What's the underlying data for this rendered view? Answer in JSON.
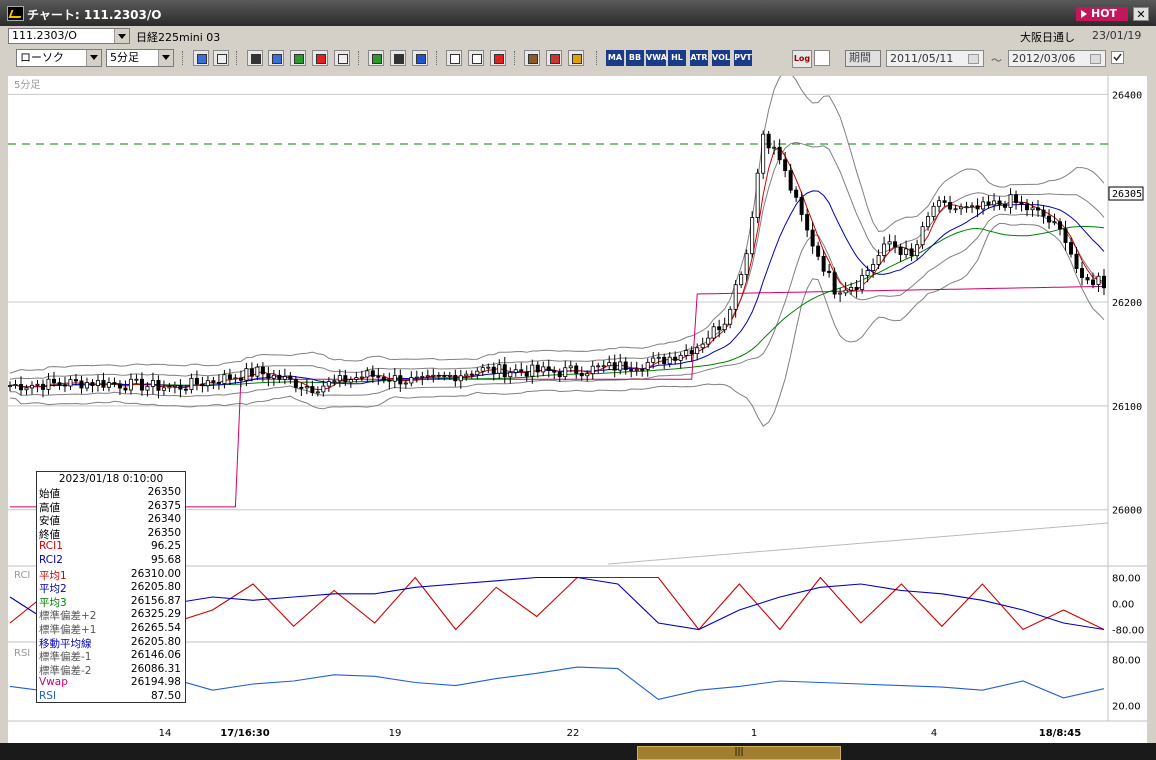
{
  "window": {
    "title": "チャート: 111.2303/O",
    "hot_label": "HOT",
    "close_label": "✕"
  },
  "header": {
    "symbol_code": "111.2303/O",
    "instrument_name": "日経225mini 03",
    "session": "大阪日通し",
    "date": "23/01/19"
  },
  "toolbar": {
    "chart_type": "ローソク",
    "interval": "5分足",
    "range_mode": "期間",
    "date_from": "2011/05/11",
    "date_to": "2012/03/06",
    "tilde": "〜",
    "icons": [
      "zoom-icon",
      "crosshair-icon",
      "grab-icon",
      "search-chart-icon",
      "bar-chart-icon",
      "candle-icon",
      "warning-icon",
      "pen-icon",
      "cursor-icon",
      "undo-icon",
      "candle-left-icon",
      "candle-right-icon",
      "all-icon",
      "gear-icon",
      "wrench-icon",
      "palette-icon"
    ],
    "indicator_buttons": [
      "MA",
      "BB",
      "VWAP",
      "HL",
      "ATR",
      "VOL",
      "PVT",
      "Log"
    ]
  },
  "chart": {
    "interval_label": "5分足",
    "price_labels": [
      "26400",
      "26305",
      "26200",
      "26100",
      "26000"
    ],
    "rci_label": "RCI",
    "rsi_label": "RSI",
    "rci_ticks": [
      "80.00",
      "0.00",
      "-80.00"
    ],
    "rsi_ticks": [
      "80.00",
      "20.00"
    ],
    "x_labels": [
      "14",
      "17/16:30",
      "19",
      "22",
      "1",
      "4",
      "18/8:45"
    ],
    "colors": {
      "up": "#ffffff",
      "down": "#000000",
      "ma1": "#d00000",
      "ma2": "#0000c0",
      "ma3": "#008000",
      "vwap": "#d0006a",
      "band": "#808080",
      "rsi": "#1e5fd6",
      "dashed": "#008000"
    }
  },
  "chart_data": {
    "type": "line",
    "title": "",
    "series": [
      {
        "name": "RCI1",
        "values": [
          -60,
          40,
          -70,
          50,
          -60,
          -20,
          60,
          -70,
          40,
          -60,
          80,
          -80,
          50,
          -40,
          80,
          80,
          80,
          -80,
          60,
          -80,
          80,
          -60,
          60,
          -70,
          60,
          -80,
          -20,
          -80
        ]
      },
      {
        "name": "RCI2",
        "values": [
          20,
          -60,
          -40,
          -30,
          0,
          20,
          10,
          20,
          30,
          30,
          50,
          60,
          70,
          80,
          80,
          60,
          -60,
          -80,
          -20,
          20,
          50,
          60,
          40,
          30,
          10,
          -20,
          -60,
          -80
        ]
      },
      {
        "name": "RSI",
        "values": [
          45,
          38,
          50,
          42,
          55,
          40,
          48,
          52,
          60,
          58,
          50,
          46,
          55,
          62,
          70,
          68,
          28,
          40,
          45,
          52,
          50,
          48,
          46,
          44,
          40,
          52,
          30,
          42
        ]
      }
    ],
    "ylim_price": [
      25940,
      26410
    ],
    "rci_ylim": [
      -100,
      100
    ],
    "rsi_ylim": [
      0,
      100
    ]
  },
  "infobox": {
    "datetime": "2023/01/18 0:10:00",
    "rows": [
      {
        "k": "始値",
        "v": "26350",
        "c": "#000000"
      },
      {
        "k": "高値",
        "v": "26375",
        "c": "#000000"
      },
      {
        "k": "安値",
        "v": "26340",
        "c": "#000000"
      },
      {
        "k": "終値",
        "v": "26350",
        "c": "#000000"
      },
      {
        "k": "RCI1",
        "v": "96.25",
        "c": "#d00000"
      },
      {
        "k": "RCI2",
        "v": "95.68",
        "c": "#0000c0"
      },
      {
        "k": "平均1",
        "v": "26310.00",
        "c": "#d00000"
      },
      {
        "k": "平均2",
        "v": "26205.80",
        "c": "#0000c0"
      },
      {
        "k": "平均3",
        "v": "26156.87",
        "c": "#008000"
      },
      {
        "k": "標準偏差+2",
        "v": "26325.29",
        "c": "#555555"
      },
      {
        "k": "標準偏差+1",
        "v": "26265.54",
        "c": "#555555"
      },
      {
        "k": "移動平均線",
        "v": "26205.80",
        "c": "#0000c0"
      },
      {
        "k": "標準偏差-1",
        "v": "26146.06",
        "c": "#555555"
      },
      {
        "k": "標準偏差-2",
        "v": "26086.31",
        "c": "#555555"
      },
      {
        "k": "Vwap",
        "v": "26194.98",
        "c": "#d0006a"
      },
      {
        "k": "RSI",
        "v": "87.50",
        "c": "#1e5fd6"
      }
    ]
  }
}
